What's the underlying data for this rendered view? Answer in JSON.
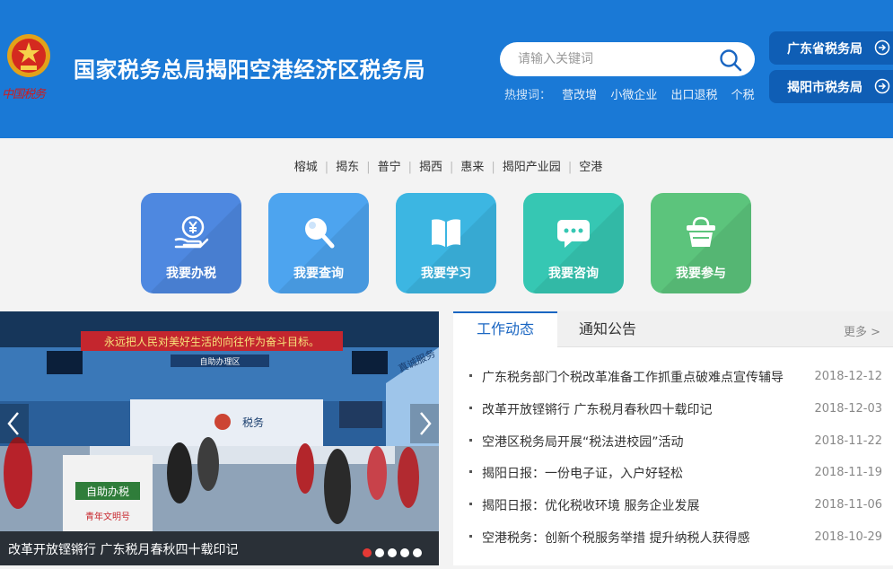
{
  "header": {
    "emblem_text": "中国税务",
    "site_title": "国家税务总局揭阳空港经济区税务局",
    "search": {
      "placeholder": "请输入关键词"
    },
    "hot_label": "热搜词：",
    "hot_words": [
      "营改增",
      "小微企业",
      "出口退税",
      "个税"
    ],
    "side_buttons": [
      "广东省税务局",
      "揭阳市税务局"
    ],
    "colors": {
      "header_bg": "#1a79d6",
      "side_button_bg": "#0f5eb5"
    }
  },
  "city_nav": [
    "榕城",
    "揭东",
    "普宁",
    "揭西",
    "惠来",
    "揭阳产业园",
    "空港"
  ],
  "services": [
    {
      "label": "我要办税",
      "icon": "yuan-hand-icon",
      "color": "#4e88e0"
    },
    {
      "label": "我要查询",
      "icon": "magnifier-icon",
      "color": "#4da4ef"
    },
    {
      "label": "我要学习",
      "icon": "book-icon",
      "color": "#3cb6e2"
    },
    {
      "label": "我要咨询",
      "icon": "chat-bubble-icon",
      "color": "#36c7b3"
    },
    {
      "label": "我要参与",
      "icon": "basket-icon",
      "color": "#5cc47c"
    }
  ],
  "carousel": {
    "caption": "改革开放铿锵行 广东税月春秋四十载印记",
    "banner_text": "永远把人民对美好生活的向往作为奋斗目标。",
    "photo_sign_area": "自助办理区",
    "photo_sign_tax": "税务",
    "photo_desk_label": "自助办税",
    "photo_desk_brand": "青年文明号",
    "photo_wall_text": "真诚服务",
    "slide_count": 5,
    "active_slide": 1
  },
  "news": {
    "tabs": [
      "工作动态",
      "通知公告"
    ],
    "more": "更多 >",
    "items": [
      {
        "title": "广东税务部门个税改革准备工作抓重点破难点宣传辅导",
        "date": "2018-12-12"
      },
      {
        "title": "改革开放铿锵行 广东税月春秋四十载印记",
        "date": "2018-12-03"
      },
      {
        "title": "空港区税务局开展“税法进校园”活动",
        "date": "2018-11-22"
      },
      {
        "title": "揭阳日报：一份电子证，入户好轻松",
        "date": "2018-11-19"
      },
      {
        "title": "揭阳日报：优化税收环境 服务企业发展",
        "date": "2018-11-06"
      },
      {
        "title": "空港税务：创新个税服务举措 提升纳税人获得感",
        "date": "2018-10-29"
      }
    ]
  }
}
